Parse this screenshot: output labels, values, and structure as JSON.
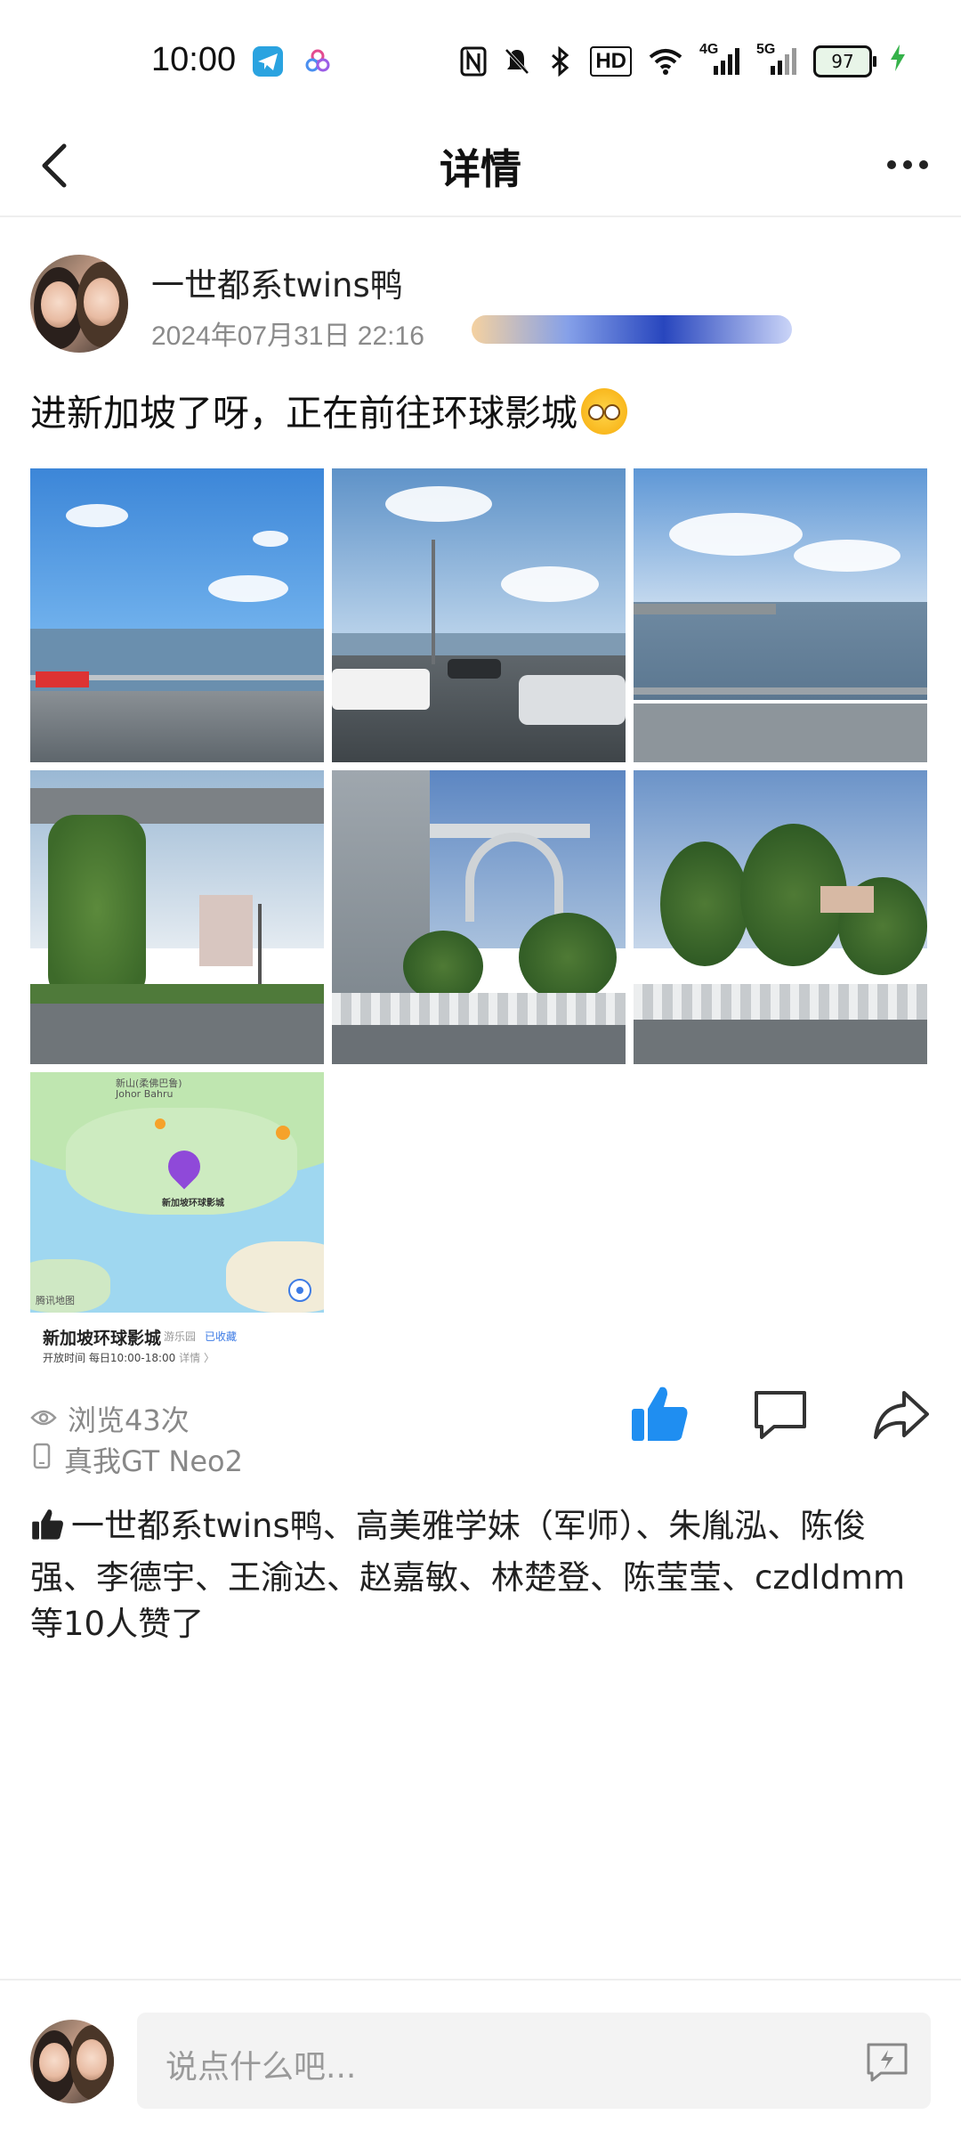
{
  "status_bar": {
    "time": "10:00",
    "signal_4g": "4G",
    "signal_5g": "5G",
    "hd_label": "HD",
    "battery": "97"
  },
  "header": {
    "title": "详情"
  },
  "post": {
    "author": "一世都系twins鸭",
    "timestamp": "2024年07月31日 22:16",
    "text": "进新加坡了呀，正在前往环球影城",
    "photo_count": 6,
    "map_card": {
      "place_name": "新加坡环球影城",
      "category": "游乐园",
      "saved_tag": "已收藏",
      "hours": "开放时间 每日10:00-18:00",
      "details_link": "详情 〉",
      "map_label_cn": "新山(柔佛巴鲁)",
      "map_label_en": "Johor Bahru",
      "pin_label": "新加坡环球影城",
      "map_brand": "腾讯地图"
    },
    "views": "浏览43次",
    "device": "真我GT Neo2",
    "likes_text": "一世都系twins鸭、高美雅学妹（军师）、朱胤泓、陈俊强、李德宇、王渝达、赵嘉敏、林楚登、陈莹莹、czdldmm等10人赞了",
    "liked": true
  },
  "comment_bar": {
    "placeholder": "说点什么吧..."
  },
  "colors": {
    "accent": "#1f8ef1",
    "charging": "#35b24a",
    "muted_text": "#888888"
  },
  "icons": [
    "back-icon",
    "more-icon",
    "eye-icon",
    "phone-icon",
    "thumbs-up-icon",
    "comment-icon",
    "share-icon",
    "emoji-keyboard-icon"
  ]
}
